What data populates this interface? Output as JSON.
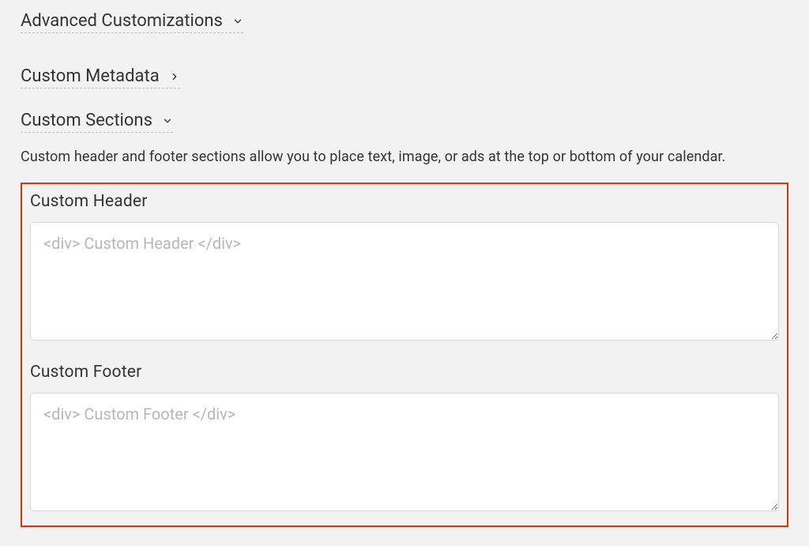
{
  "sections": {
    "advanced": {
      "label": "Advanced Customizations"
    },
    "metadata": {
      "label": "Custom Metadata"
    },
    "custom_sections": {
      "label": "Custom Sections",
      "description": "Custom header and footer sections allow you to place text, image, or ads at the top or bottom of your calendar."
    }
  },
  "fields": {
    "custom_header": {
      "label": "Custom Header",
      "placeholder": "<div> Custom Header </div>",
      "value": ""
    },
    "custom_footer": {
      "label": "Custom Footer",
      "placeholder": "<div> Custom Footer </div>",
      "value": ""
    }
  }
}
